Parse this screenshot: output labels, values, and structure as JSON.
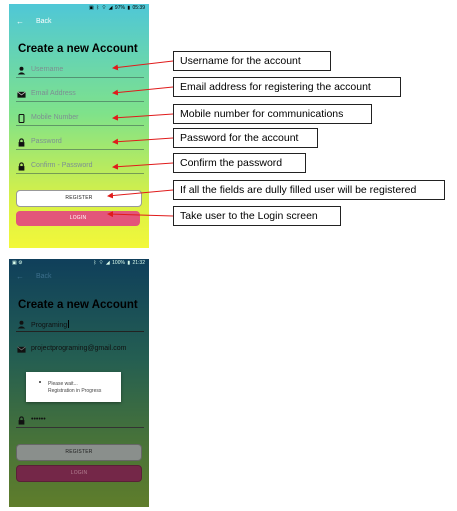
{
  "screen1": {
    "status": {
      "icons": [
        "battery-saver-icon",
        "bluetooth-icon",
        "wifi-icon",
        "signal-icon",
        "battery-icon"
      ],
      "battery": "97%",
      "time": "05:39"
    },
    "back_label": "Back",
    "title": "Create a new Account",
    "fields": {
      "username": {
        "placeholder": "Username",
        "value": ""
      },
      "email": {
        "placeholder": "Email Address",
        "value": ""
      },
      "mobile": {
        "placeholder": "Mobile Number",
        "value": ""
      },
      "password": {
        "placeholder": "Password",
        "value": ""
      },
      "confirm": {
        "placeholder": "Confirm - Password",
        "value": ""
      }
    },
    "register_label": "REGISTER",
    "login_label": "LOGIN"
  },
  "screen2": {
    "status": {
      "icons": [
        "gallery-icon",
        "settings-icon",
        "bluetooth-icon",
        "wifi-icon",
        "signal-icon",
        "battery-icon"
      ],
      "battery": "100%",
      "time": "21:32"
    },
    "back_label": "Back",
    "title": "Create a new Account",
    "fields": {
      "username": {
        "value": "Programing"
      },
      "email": {
        "value": "projectprograming@gmail.com"
      },
      "password": {
        "value": "••••••"
      }
    },
    "dialog": {
      "line1": "Please wait...",
      "line2": "Registration in Progress"
    },
    "register_label": "REGISTER",
    "login_label": "LOGIN"
  },
  "annotations": [
    "Username for the account",
    "Email address for registering the account",
    "Mobile number for communications",
    "Password for the account",
    "Confirm the password",
    "If all the fields are dully filled user will be registered",
    "Take user to the Login screen"
  ],
  "colors": {
    "login_button": "#e3557a",
    "arrow": "#e01b1b",
    "phone1_gradient": [
      "#4fc7d7",
      "#7fe28a",
      "#f2f83a"
    ],
    "phone2_gradient": [
      "#0f3f5b",
      "#46723a",
      "#5f7d2b"
    ]
  }
}
